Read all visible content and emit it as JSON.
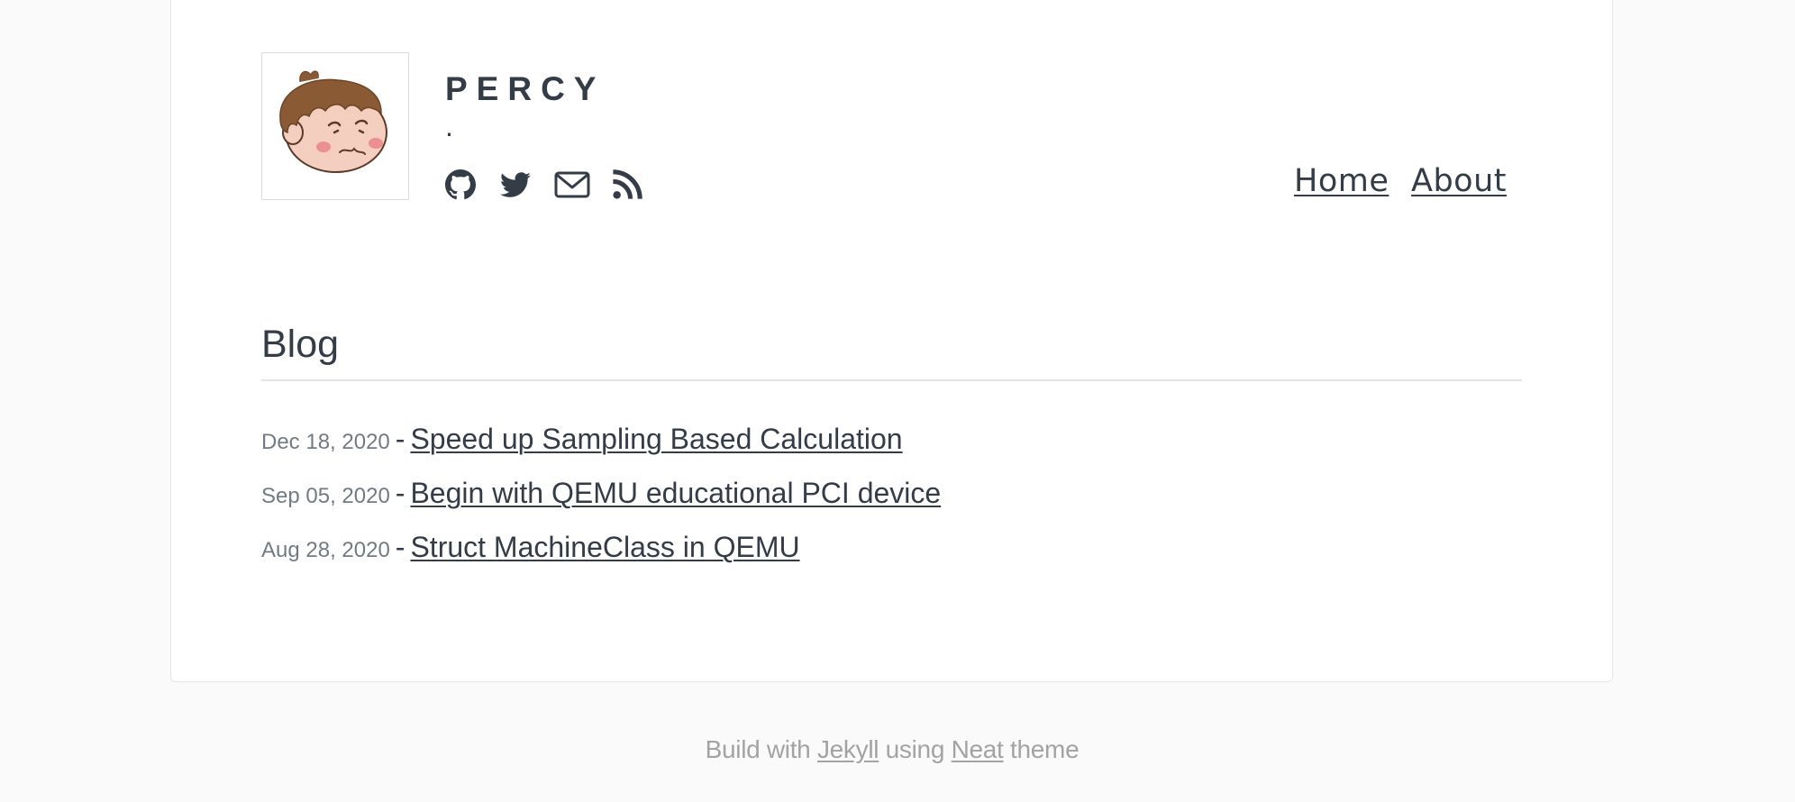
{
  "header": {
    "site_title": "PERCY",
    "subtitle": ".",
    "social_icons": [
      "github-icon",
      "twitter-icon",
      "mail-icon",
      "rss-icon"
    ],
    "nav": [
      {
        "label": "Home"
      },
      {
        "label": "About"
      }
    ]
  },
  "blog": {
    "title": "Blog",
    "posts": [
      {
        "date": "Dec 18, 2020",
        "separator": "-",
        "title": "Speed up Sampling Based Calculation"
      },
      {
        "date": "Sep 05, 2020",
        "separator": "-",
        "title": "Begin with QEMU educational PCI device"
      },
      {
        "date": "Aug 28, 2020",
        "separator": "-",
        "title": "Struct MachineClass in QEMU"
      }
    ]
  },
  "footer": {
    "prefix": "Build with",
    "link1": "Jekyll",
    "middle": "using",
    "link2": "Neat",
    "suffix": "theme"
  },
  "colors": {
    "text": "#333c47",
    "muted": "#727b84",
    "footer": "#a3a3a3",
    "background": "#fafafa",
    "card": "#ffffff"
  }
}
